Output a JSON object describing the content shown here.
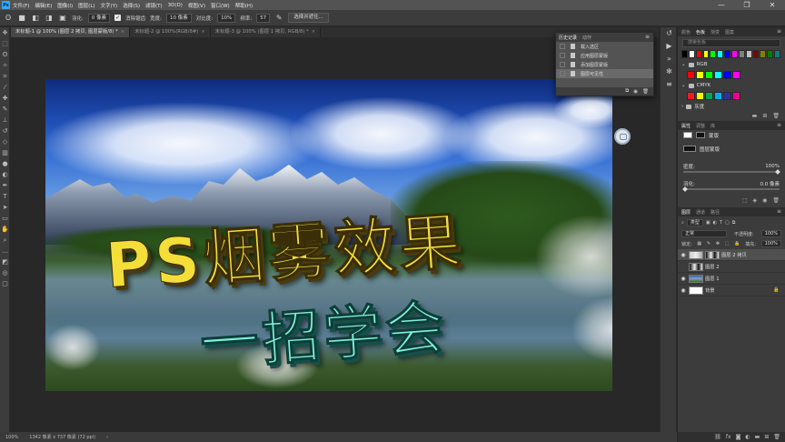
{
  "menu": {
    "items": [
      "文件(F)",
      "编辑(E)",
      "图像(I)",
      "图层(L)",
      "文字(Y)",
      "选择(S)",
      "滤镜(T)",
      "3D(D)",
      "视图(V)",
      "窗口(W)",
      "帮助(H)"
    ],
    "logo": "Ps"
  },
  "window_controls": {
    "minimize": "—",
    "restore": "❐",
    "close": "✕"
  },
  "options_bar": {
    "feather_label": "羽化:",
    "feather_value": "0 像素",
    "antialias_label": "消除锯齿",
    "style_label": "样式:",
    "style_value": "正常",
    "width_label": "宽度:",
    "width_value": "10 像素",
    "contrast_label": "对比度:",
    "contrast_value": "10%",
    "frequency_label": "频率:",
    "frequency_value": "57",
    "select_subject_button": "选择并遮住..."
  },
  "doc_tabs": [
    {
      "label": "未标题-1 @ 100% (图层 2 拷贝, 图层蒙版/8) *",
      "active": true
    },
    {
      "label": "未标题-2 @ 100%(RGB/8#)",
      "active": false
    },
    {
      "label": "未标题-3 @ 100% (图层 1 拷贝, RGB/8) *",
      "active": false
    }
  ],
  "canvas": {
    "title_line1": "PS烟雾效果",
    "title_line2": "一招学会"
  },
  "history_panel": {
    "tabs": [
      "历史记录",
      "动作"
    ],
    "items": [
      {
        "label": "载入选区",
        "selected": false
      },
      {
        "label": "应用图层蒙版",
        "selected": false
      },
      {
        "label": "添加图层蒙版",
        "selected": false
      },
      {
        "label": "图层可见性",
        "selected": true
      }
    ]
  },
  "swatches_panel": {
    "tabs": [
      "颜色",
      "色板",
      "渐变",
      "图案"
    ],
    "search_placeholder": "搜索色板",
    "groups": [
      "RGB",
      "CMYK",
      "灰度"
    ],
    "top_colors": [
      "#000000",
      "#ffffff",
      "#ff0000",
      "#ffff00",
      "#00ff00",
      "#00ffff",
      "#0000ff",
      "#ff00ff",
      "#808080",
      "#c0c0c0",
      "#800000",
      "#808000",
      "#008000",
      "#008080"
    ],
    "rgb_colors": [
      "#ff0000",
      "#ffff00",
      "#00ff00",
      "#00ffff",
      "#0000ff",
      "#ff00ff"
    ],
    "cmyk_colors": [
      "#ec1c24",
      "#fff200",
      "#00a651",
      "#00aeef",
      "#2e3192",
      "#ec008c"
    ]
  },
  "properties_panel": {
    "tabs": [
      "属性",
      "调整",
      "库"
    ],
    "kind_label": "蒙版",
    "layer_mask_label": "图层蒙版",
    "density_label": "密度:",
    "density_value": "100%",
    "feather_label": "羽化:",
    "feather_value": "0.0 像素"
  },
  "layers_panel": {
    "tabs": [
      "图层",
      "通道",
      "路径"
    ],
    "filter_value": "类型",
    "blend_mode": "正常",
    "opacity_label": "不透明度:",
    "opacity_value": "100%",
    "lock_label": "锁定:",
    "fill_label": "填充:",
    "fill_value": "100%",
    "layers": [
      {
        "name": "图层 2 拷贝",
        "selected": true,
        "visible": true,
        "thumb": "cloud",
        "mask": true
      },
      {
        "name": "图层 2",
        "selected": false,
        "visible": false,
        "thumb": "mask",
        "mask": false
      },
      {
        "name": "图层 1",
        "selected": false,
        "visible": true,
        "thumb": "photo",
        "mask": false
      },
      {
        "name": "背景",
        "selected": false,
        "visible": true,
        "thumb": "white",
        "mask": false
      }
    ]
  },
  "status_bar": {
    "zoom": "100%",
    "doc_info": "1342 像素 x 737 像素 (72 ppi)"
  }
}
